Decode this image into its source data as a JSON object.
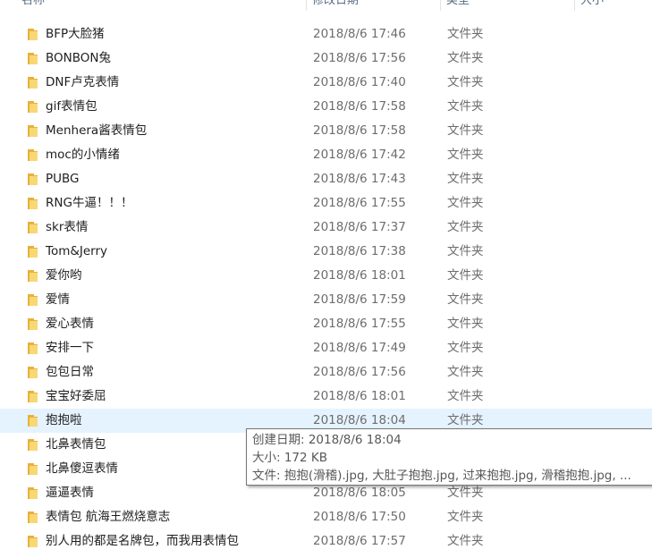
{
  "columns": {
    "name": "名称",
    "date": "修改日期",
    "type": "类型",
    "size": "大小"
  },
  "icon": "folder-icon",
  "colors": {
    "folder_back": "#e8b13a",
    "folder_front": "#f8d775",
    "hover_bg": "#e5f3ff"
  },
  "files": [
    {
      "name": "BFP大脸猪",
      "date": "2018/8/6 17:46",
      "type": "文件夹"
    },
    {
      "name": "BONBON兔",
      "date": "2018/8/6 17:56",
      "type": "文件夹"
    },
    {
      "name": "DNF卢克表情",
      "date": "2018/8/6 17:40",
      "type": "文件夹"
    },
    {
      "name": "gif表情包",
      "date": "2018/8/6 17:58",
      "type": "文件夹"
    },
    {
      "name": "Menhera酱表情包",
      "date": "2018/8/6 17:58",
      "type": "文件夹"
    },
    {
      "name": "moc的小情绪",
      "date": "2018/8/6 17:42",
      "type": "文件夹"
    },
    {
      "name": "PUBG",
      "date": "2018/8/6 17:43",
      "type": "文件夹"
    },
    {
      "name": "RNG牛逼！！！",
      "date": "2018/8/6 17:55",
      "type": "文件夹"
    },
    {
      "name": "skr表情",
      "date": "2018/8/6 17:37",
      "type": "文件夹"
    },
    {
      "name": "Tom&Jerry",
      "date": "2018/8/6 17:38",
      "type": "文件夹"
    },
    {
      "name": "爱你哟",
      "date": "2018/8/6 18:01",
      "type": "文件夹"
    },
    {
      "name": "爱情",
      "date": "2018/8/6 17:59",
      "type": "文件夹"
    },
    {
      "name": "爱心表情",
      "date": "2018/8/6 17:55",
      "type": "文件夹"
    },
    {
      "name": "安排一下",
      "date": "2018/8/6 17:49",
      "type": "文件夹"
    },
    {
      "name": "包包日常",
      "date": "2018/8/6 17:56",
      "type": "文件夹"
    },
    {
      "name": "宝宝好委屈",
      "date": "2018/8/6 18:01",
      "type": "文件夹"
    },
    {
      "name": "抱抱啦",
      "date": "2018/8/6 18:04",
      "type": "文件夹",
      "hover": true
    },
    {
      "name": "北鼻表情包",
      "date": "",
      "type": ""
    },
    {
      "name": "北鼻傻逗表情",
      "date": "",
      "type": ""
    },
    {
      "name": "逼逼表情",
      "date": "2018/8/6 18:05",
      "type": "文件夹"
    },
    {
      "name": "表情包 航海王燃烧意志",
      "date": "2018/8/6 17:50",
      "type": "文件夹"
    },
    {
      "name": "别人用的都是名牌包，而我用表情包",
      "date": "2018/8/6 17:57",
      "type": "文件夹"
    }
  ],
  "tooltip": {
    "created": "创建日期: 2018/8/6 18:04",
    "size": "大小: 172 KB",
    "files": "文件: 抱抱(滑稽).jpg, 大肚子抱抱.jpg, 过来抱抱.jpg, 滑稽抱抱.jpg, ..."
  }
}
